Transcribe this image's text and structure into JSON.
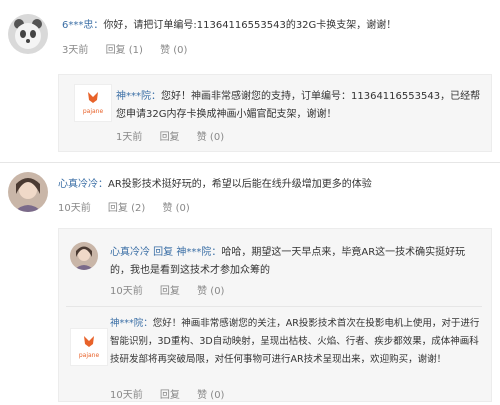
{
  "comments": [
    {
      "user": "6***忠：",
      "text": "你好，请把订单编号:11364116553543的32G卡换支架，谢谢！",
      "time": "3天前",
      "reply_label": "回复 (1)",
      "like_label": "赞 (0)",
      "replies": [
        {
          "logo_text": "pajane",
          "user": "神***院：",
          "text": "您好！神画非常感谢您的支持，订单编号：11364116553543，已经帮您申请32G内存卡换成神画小媚官配支架，谢谢！",
          "time": "1天前",
          "reply_label": "回复",
          "like_label": "赞 (0)"
        }
      ]
    },
    {
      "user": "心真冷冷：",
      "text": "AR投影技术挺好玩的，希望以后能在线升级增加更多的体验",
      "time": "10天前",
      "reply_label": "回复 (2)",
      "like_label": "赞 (0)",
      "replies": [
        {
          "user": "心真冷冷 回复 神***院：",
          "text": "哈哈，期望这一天早点来，毕竟AR这一技术确实挺好玩的，我也是看到这技术才参加众筹的",
          "time": "10天前",
          "reply_label": "回复",
          "like_label": "赞 (0)"
        },
        {
          "logo_text": "pajane",
          "user": "神***院：",
          "text": "您好！神画非常感谢您的关注，AR投影技术首次在投影电机上使用，对于进行智能识别，3D重构、3D自动映射，呈现出枯枝、火焰、行者、疾步都效果，成体神画科技研发部将再突破局限，对任何事物可进行AR技术呈现出来，欢迎购买，谢谢！",
          "time": "10天前",
          "reply_label": "回复",
          "like_label": "赞 (0)"
        }
      ]
    }
  ],
  "colors": {
    "link": "#3a6ea5",
    "meta": "#888888",
    "logo": "#e8622a"
  }
}
